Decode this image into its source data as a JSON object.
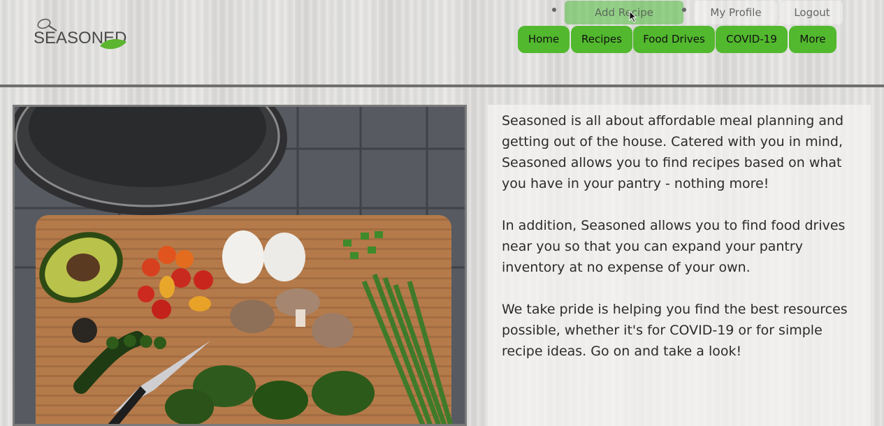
{
  "logo": {
    "text": "SEASONED"
  },
  "top_links": [
    {
      "label": "Add Recipe"
    },
    {
      "label": "My Profile"
    },
    {
      "label": "Logout"
    }
  ],
  "nav": [
    {
      "label": "Home"
    },
    {
      "label": "Recipes"
    },
    {
      "label": "Food Drives"
    },
    {
      "label": "COVID-19"
    },
    {
      "label": "More"
    }
  ],
  "about": {
    "paragraphs": [
      "Seasoned is all about affordable meal planning and getting out of the house. Catered with you in mind, Seasoned allows you to find recipes based on what you have in your pantry - nothing more!",
      "In addition, Seasoned allows you to find food drives near you so that you can expand your pantry inventory at no expense of your own.",
      "We take pride is helping you find the best resources possible, whether it's for COVID-19 or for simple recipe ideas. Go on and take a look!"
    ]
  },
  "colors": {
    "accent": "#52b82e",
    "divider": "#6f6f6f"
  },
  "icons": [
    "whisk-icon",
    "leaf-icon",
    "cursor-icon"
  ]
}
